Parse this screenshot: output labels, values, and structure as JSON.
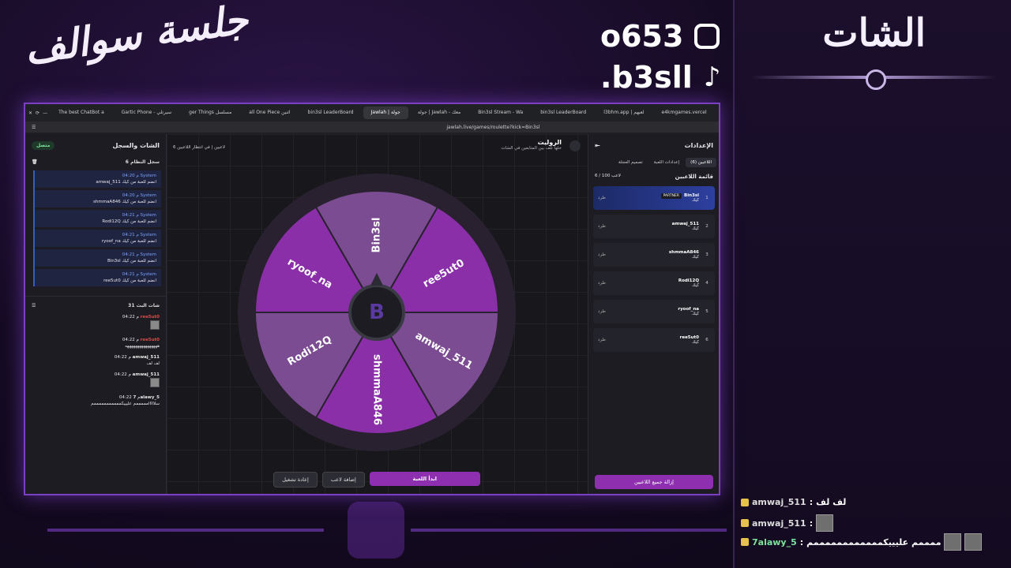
{
  "brand": {
    "logo_text": "جلسة سوالف"
  },
  "socials": [
    {
      "icon": "instagram-icon",
      "handle": "o653"
    },
    {
      "icon": "tiktok-icon",
      "handle": ".b3sll"
    }
  ],
  "stream_chat": {
    "title": "الشات",
    "messages": [
      {
        "user": "amwaj_511",
        "text": "لف لف"
      },
      {
        "user": "amwaj_511",
        "text": ""
      },
      {
        "user": "7alawy_5",
        "text": "سلااااااممممم عليييكممممممممممممم"
      }
    ]
  },
  "browser": {
    "tabs": [
      "The best ChatBot a",
      "Gartic Phone - سيرتلي",
      "ger Things مسلسل",
      "all One Piece اثنين",
      "bin3sl LeaderBoard",
      "Jawlah | جولة",
      "جولة | Jawlah - معك",
      "Bin3sl Stream - Wa",
      "bin3sl LeaderBoard",
      "l3bhm.app | لعبهم",
      "e4kmgames.vercel"
    ],
    "active_tab_index": 5,
    "url": "jawlah.live/games/roulette?kick=Bin3sl"
  },
  "left_panel": {
    "title": "الشات والسجل",
    "status": "متصل",
    "system_log": {
      "title": "سجل النظام",
      "count": "6",
      "entries": [
        {
          "meta": "04:20 م System",
          "text": "amwaj_511 انضم للعبة من كيك"
        },
        {
          "meta": "04:20 م System",
          "text": "shmmaA846 انضم للعبة من كيك"
        },
        {
          "meta": "04:21 م System",
          "text": "Rodi12Q انضم للعبة من كيك"
        },
        {
          "meta": "04:21 م System",
          "text": "ryoof_na انضم للعبة من كيك"
        },
        {
          "meta": "04:21 م System",
          "text": "Bin3sl انضم للعبة من كيك"
        },
        {
          "meta": "04:21 م System",
          "text": "ree5ut0 انضم للعبة من كيك"
        }
      ]
    },
    "live_chat": {
      "title": "شات البث",
      "count": "31",
      "messages": [
        {
          "time": "04:22 م",
          "user": "ree5ut0",
          "text": ""
        },
        {
          "time": "04:22 م",
          "user": "ree5ut0",
          "text": "ههههههههههههههههه"
        },
        {
          "time": "04:22 م",
          "user": "amwaj_511",
          "text": "لف لف"
        },
        {
          "time": "04:22 م",
          "user": "amwaj_511",
          "text": ""
        },
        {
          "time": "04:22 م",
          "user": "7alawy_5",
          "text": "سلااااامممممم عليييكمممممممممممم"
        }
      ]
    }
  },
  "game": {
    "title": "الروليت",
    "subtitle": "خلها تلف بين المتابعين في الشات",
    "players_tag": "6 لاعبين | في انتظار اللاعبين",
    "wheel": {
      "segments": [
        "Bin3sl",
        "ree5ut0",
        "amwaj_511",
        "shmmaA846",
        "Rodi12Q",
        "ryoof_na"
      ],
      "colors": [
        "#7b4c92",
        "#8a2fa8",
        "#7b4c92",
        "#8a2fa8",
        "#7b4c92",
        "#8a2fa8"
      ]
    },
    "buttons": {
      "reset": "إعادة تشغيل",
      "add_player": "إضافة لاعب",
      "start": "ابدأ اللعبة"
    }
  },
  "settings": {
    "title": "الإعدادات",
    "tabs": [
      "اللاعبين (6)",
      "إعدادات اللعبة",
      "تصميم العجلة"
    ],
    "list_title": "قائمة اللاعبين",
    "list_count": "6 / 100 لاعب",
    "partner_label": "PARTNER",
    "source_label": "كيك",
    "kick_label": "طرد",
    "players": [
      {
        "idx": "1",
        "name": "Bin3sl",
        "partner": true
      },
      {
        "idx": "2",
        "name": "amwaj_511",
        "partner": false
      },
      {
        "idx": "3",
        "name": "shmmaA846",
        "partner": false
      },
      {
        "idx": "4",
        "name": "Rodi12Q",
        "partner": false
      },
      {
        "idx": "5",
        "name": "ryoof_na",
        "partner": false
      },
      {
        "idx": "6",
        "name": "ree5ut0",
        "partner": false
      }
    ],
    "remove_all": "إزالة جميع اللاعبين"
  }
}
